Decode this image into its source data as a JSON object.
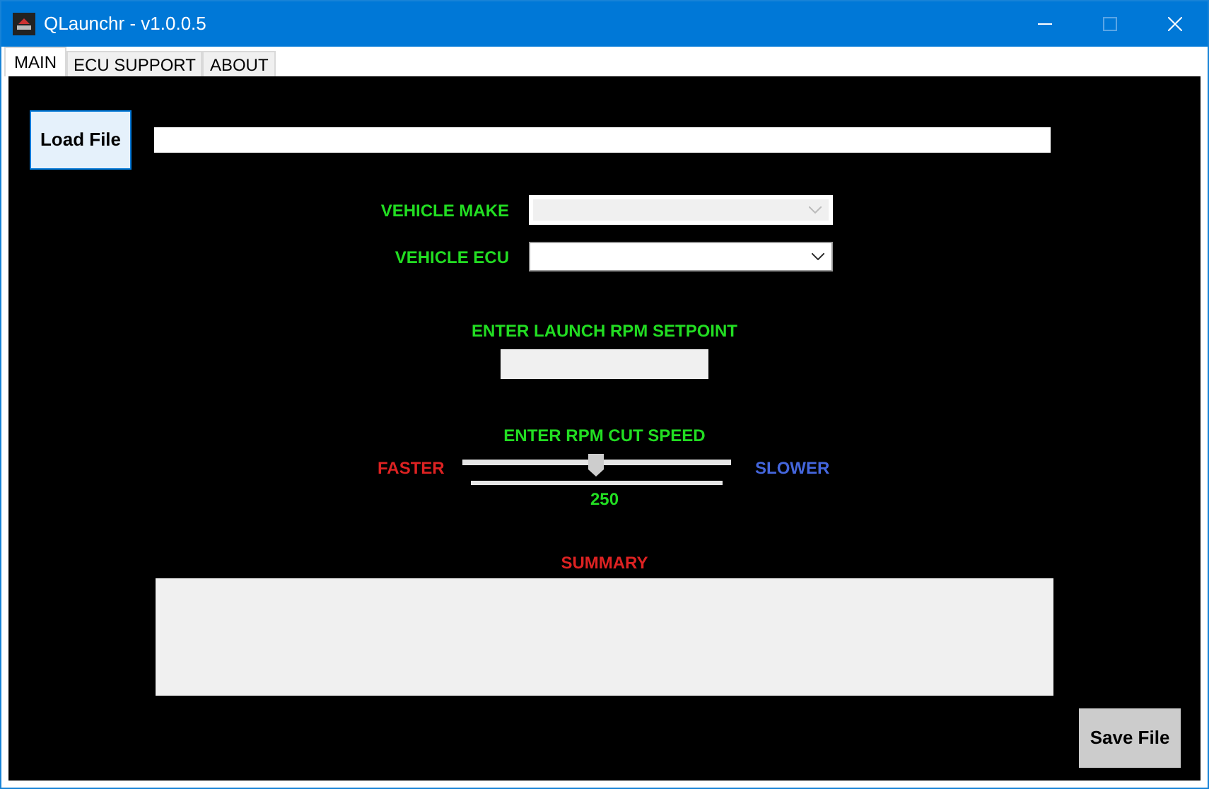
{
  "window": {
    "title": "QLaunchr - v1.0.0.5"
  },
  "tabs": [
    {
      "label": "MAIN",
      "selected": true
    },
    {
      "label": "ECU SUPPORT",
      "selected": false
    },
    {
      "label": "ABOUT",
      "selected": false
    }
  ],
  "load_button": "Load File",
  "fields": [
    {
      "label": "VEHICLE MAKE",
      "disabled": true
    },
    {
      "label": "VEHICLE ECU",
      "disabled": false
    }
  ],
  "setpoint_label": "ENTER LAUNCH RPM SETPOINT",
  "cut_speed": {
    "label": "ENTER RPM CUT SPEED",
    "left": "FASTER",
    "right": "SLOWER",
    "level": 0.5,
    "reading": "250"
  },
  "summary_label": "SUMMARY",
  "save_button": "Save File"
}
